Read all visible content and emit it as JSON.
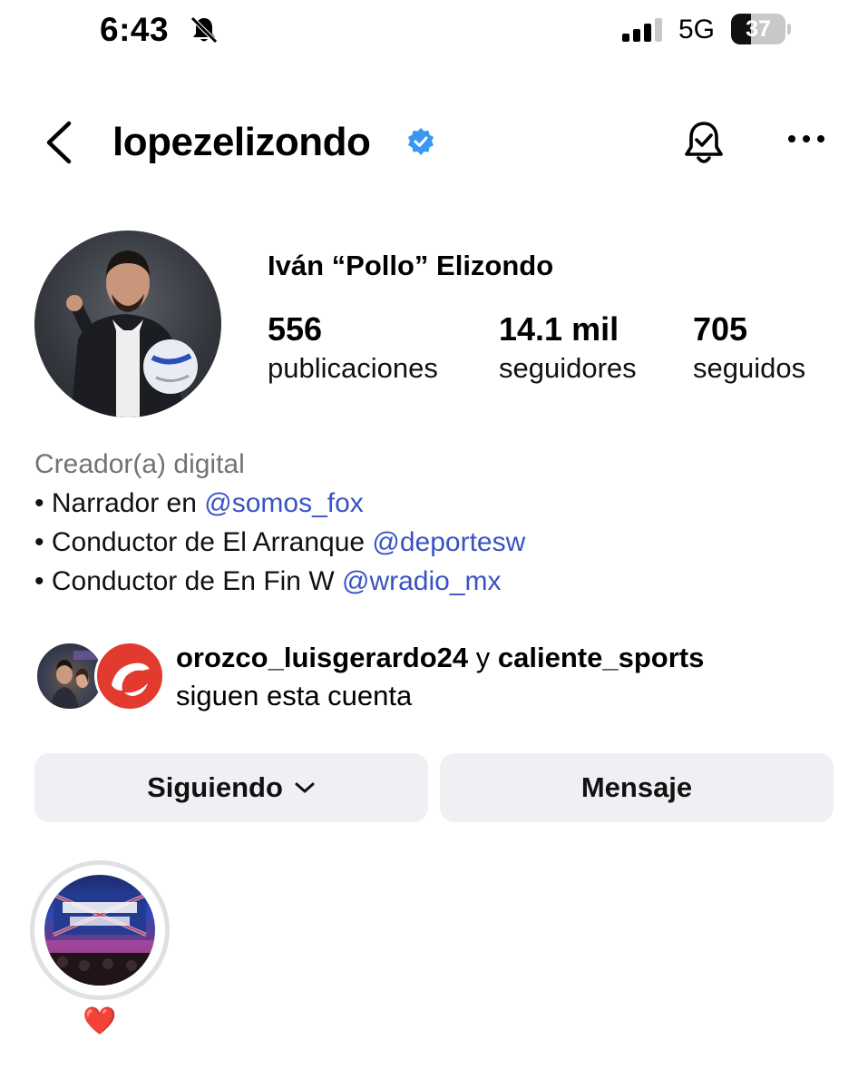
{
  "status_bar": {
    "time": "6:43",
    "network": "5G",
    "battery_level": "37",
    "battery_fraction": 0.37
  },
  "header": {
    "username": "lopezelizondo",
    "verified": true
  },
  "profile": {
    "display_name": "Iván “Pollo” Elizondo",
    "stats": [
      {
        "value": "556",
        "label": "publicaciones"
      },
      {
        "value": "14.1 mil",
        "label": "seguidores"
      },
      {
        "value": "705",
        "label": "seguidos"
      }
    ]
  },
  "bio": {
    "category": "Creador(a) digital",
    "lines": [
      {
        "text": "• Narrador en ",
        "mention": "@somos_fox"
      },
      {
        "text": "• Conductor de El Arranque ",
        "mention": "@deportesw"
      },
      {
        "text": "• Conductor de En Fin W ",
        "mention": "@wradio_mx"
      }
    ]
  },
  "followed_by": {
    "user_1": "orozco_luisgerardo24",
    "connector": " y ",
    "user_2": "caliente_sports",
    "suffix": "siguen esta cuenta"
  },
  "actions": {
    "following_label": "Siguiendo",
    "message_label": "Mensaje"
  },
  "highlights": [
    {
      "label": "❤️"
    }
  ],
  "colors": {
    "mention": "#3a53c4",
    "verified": "#3897f0",
    "button_bg": "#eff0f4",
    "category": "#737373"
  }
}
